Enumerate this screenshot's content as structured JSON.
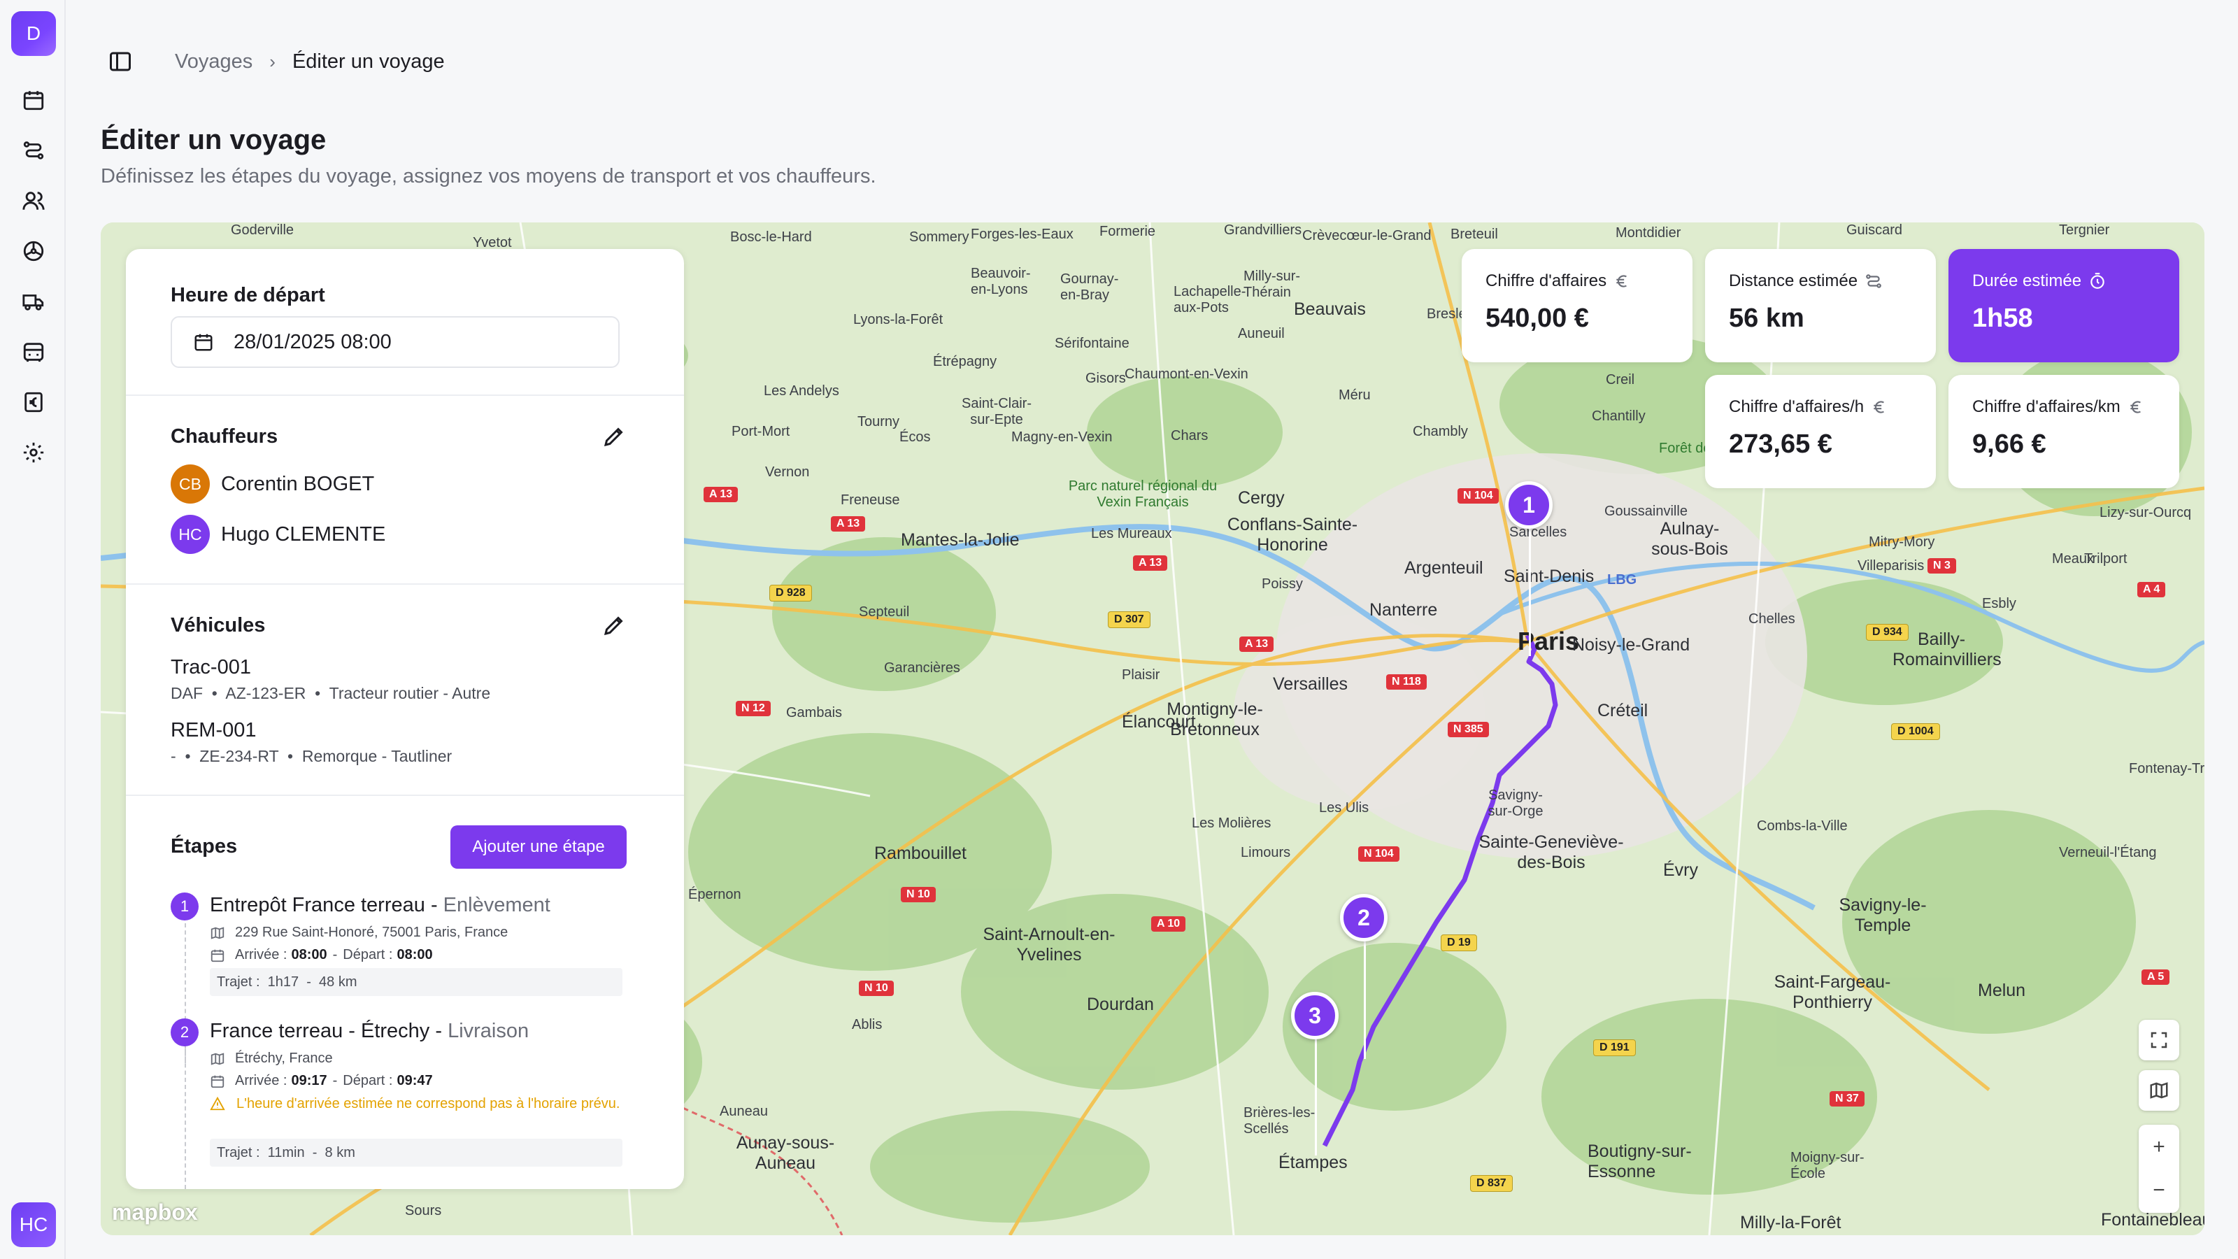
{
  "app": {
    "logo_letter": "D",
    "user_initials": "HC"
  },
  "sidebar": {
    "icons": [
      "calendar-icon",
      "route-icon",
      "users-icon",
      "steering-wheel-icon",
      "truck-icon",
      "vehicle-icon",
      "euro-receipt-icon",
      "settings-icon"
    ]
  },
  "breadcrumb": {
    "parent": "Voyages",
    "current": "Éditer un voyage"
  },
  "page": {
    "title": "Éditer un voyage",
    "subtitle": "Définissez les étapes du voyage, assignez vos moyens de transport et vos chauffeurs."
  },
  "departure": {
    "label": "Heure de départ",
    "value": "28/01/2025 08:00"
  },
  "drivers": {
    "label": "Chauffeurs",
    "items": [
      {
        "initials": "CB",
        "name": "Corentin BOGET",
        "color": "#d97706"
      },
      {
        "initials": "HC",
        "name": "Hugo CLEMENTE",
        "color": "#7c3aed"
      }
    ]
  },
  "vehicles": {
    "label": "Véhicules",
    "items": [
      {
        "name": "Trac-001",
        "brand": "DAF",
        "plate": "AZ-123-ER",
        "type": "Tracteur routier - Autre"
      },
      {
        "name": "REM-001",
        "brand": "-",
        "plate": "ZE-234-RT",
        "type": "Remorque - Tautliner"
      }
    ]
  },
  "steps": {
    "label": "Étapes",
    "add_label": "Ajouter une étape",
    "items": [
      {
        "num": "1",
        "name": "Entrepôt France terreau",
        "sep": " - ",
        "type": "Enlèvement",
        "address": "229 Rue Saint-Honoré, 75001 Paris, France",
        "arrival_label": "Arrivée :",
        "arrival": "08:00",
        "departure_label": "Départ :",
        "departure": "08:00",
        "trajet_label": "Trajet :",
        "trajet_time": "1h17",
        "trajet_dist": "48 km"
      },
      {
        "num": "2",
        "name": "France terreau - Étrechy",
        "sep": " - ",
        "type": "Livraison",
        "address": "Étréchy, France",
        "arrival_label": "Arrivée :",
        "arrival": "09:17",
        "departure_label": "Départ :",
        "departure": "09:47",
        "warning": "L'heure d'arrivée estimée ne correspond pas à l'horaire prévu.",
        "trajet_label": "Trajet :",
        "trajet_time": "11min",
        "trajet_dist": "8 km"
      }
    ]
  },
  "stats": {
    "revenue": {
      "label": "Chiffre d'affaires",
      "value": "540,00 €"
    },
    "distance": {
      "label": "Distance estimée",
      "value": "56 km"
    },
    "duration": {
      "label": "Durée estimée",
      "value": "1h58"
    },
    "revenue_per_hour": {
      "label": "Chiffre d'affaires/h",
      "value": "273,65 €"
    },
    "revenue_per_km": {
      "label": "Chiffre d'affaires/km",
      "value": "9,66 €"
    }
  },
  "map": {
    "attribution": "mapbox",
    "markers": [
      "1",
      "2",
      "3"
    ],
    "park_label": "Parc naturel régional du Vexin Français",
    "forest_label": "Forêt de Chan",
    "cities_big": [
      "Paris"
    ],
    "cities_mid": [
      "Versailles",
      "Nanterre",
      "Argenteuil",
      "Saint-Denis",
      "Cergy",
      "Évry",
      "Melun",
      "Étampes",
      "Créteil",
      "Dourdan",
      "Rambouillet",
      "Mantes-la-Jolie",
      "Noisy-le-Grand",
      "Aulnay-sous-Bois",
      "Savigny-sur-Orge"
    ],
    "cities_small": [
      "Goderville",
      "Yvetot",
      "Bosc-le-Hard",
      "Sommery",
      "Forges-les-Eaux",
      "Formerie",
      "Grandvilliers",
      "Crèvecœur-le-Grand",
      "Breteuil",
      "Montdidier",
      "Guiscard",
      "Tergnier",
      "Beauvais",
      "Gisors",
      "Étrépagny",
      "Les Andelys",
      "Vernon",
      "Freneuse",
      "Poissy",
      "Plaisir",
      "Gambais",
      "Garancières",
      "Limours",
      "Les Ulis",
      "Ablis",
      "Auneau",
      "Sours",
      "Épernon",
      "Chelles",
      "Meaux",
      "Esbly",
      "Creil",
      "Chantilly",
      "Chambly",
      "Méru",
      "Auneuil",
      "Sérifontaine",
      "Chaumont-en-Vexin",
      "Magny-en-Vexin",
      "Tourny",
      "Écos",
      "Chars",
      "Port-Mort",
      "Septeuil",
      "Les Mureaux",
      "Sarcelles",
      "Goussainville",
      "Mitry-Mory",
      "Villeparisis",
      "Trilport",
      "Lizy-sur-Ourcq",
      "Combs-la-Ville",
      "Verneuil-l'Étang",
      "Fontenay-Trésigny",
      "Brières-les-Scellés",
      "Boutigny-sur-Essonne",
      "Moigny-sur-École",
      "Milly-la-Forêt",
      "Fontainebleau",
      "Saint-Fargeau-Ponthierry",
      "Savigny-le-Temple",
      "Saint-Arnoult-en-Yvelines",
      "Les Molières",
      "Élancourt",
      "Montigny-le-Bretonneux",
      "Sainte-Geneviève-des-Bois",
      "Conflans-Sainte-Honorine",
      "Bailly-Romainvilliers",
      "Aunay-sous-Auneau",
      "Lyons-la-Forêt",
      "Gournay-en-Bray",
      "Lachapelle-aux-Pots",
      "Milly-sur-Thérain",
      "Beauvoir-en-Lyons",
      "Saint-Clair-sur-Epte",
      "Bresle"
    ],
    "roads_red": [
      "A 13",
      "A 13",
      "A 13",
      "A 13",
      "N 12",
      "N 10",
      "N 10",
      "A 10",
      "N 118",
      "N 385",
      "N 104",
      "N 104",
      "N 3",
      "A 4",
      "A 5",
      "N 37"
    ],
    "roads_yellow": [
      "D 928",
      "D 307",
      "D 19",
      "D 191",
      "D 837",
      "D 934",
      "D 1004"
    ],
    "airport": "LBG"
  }
}
